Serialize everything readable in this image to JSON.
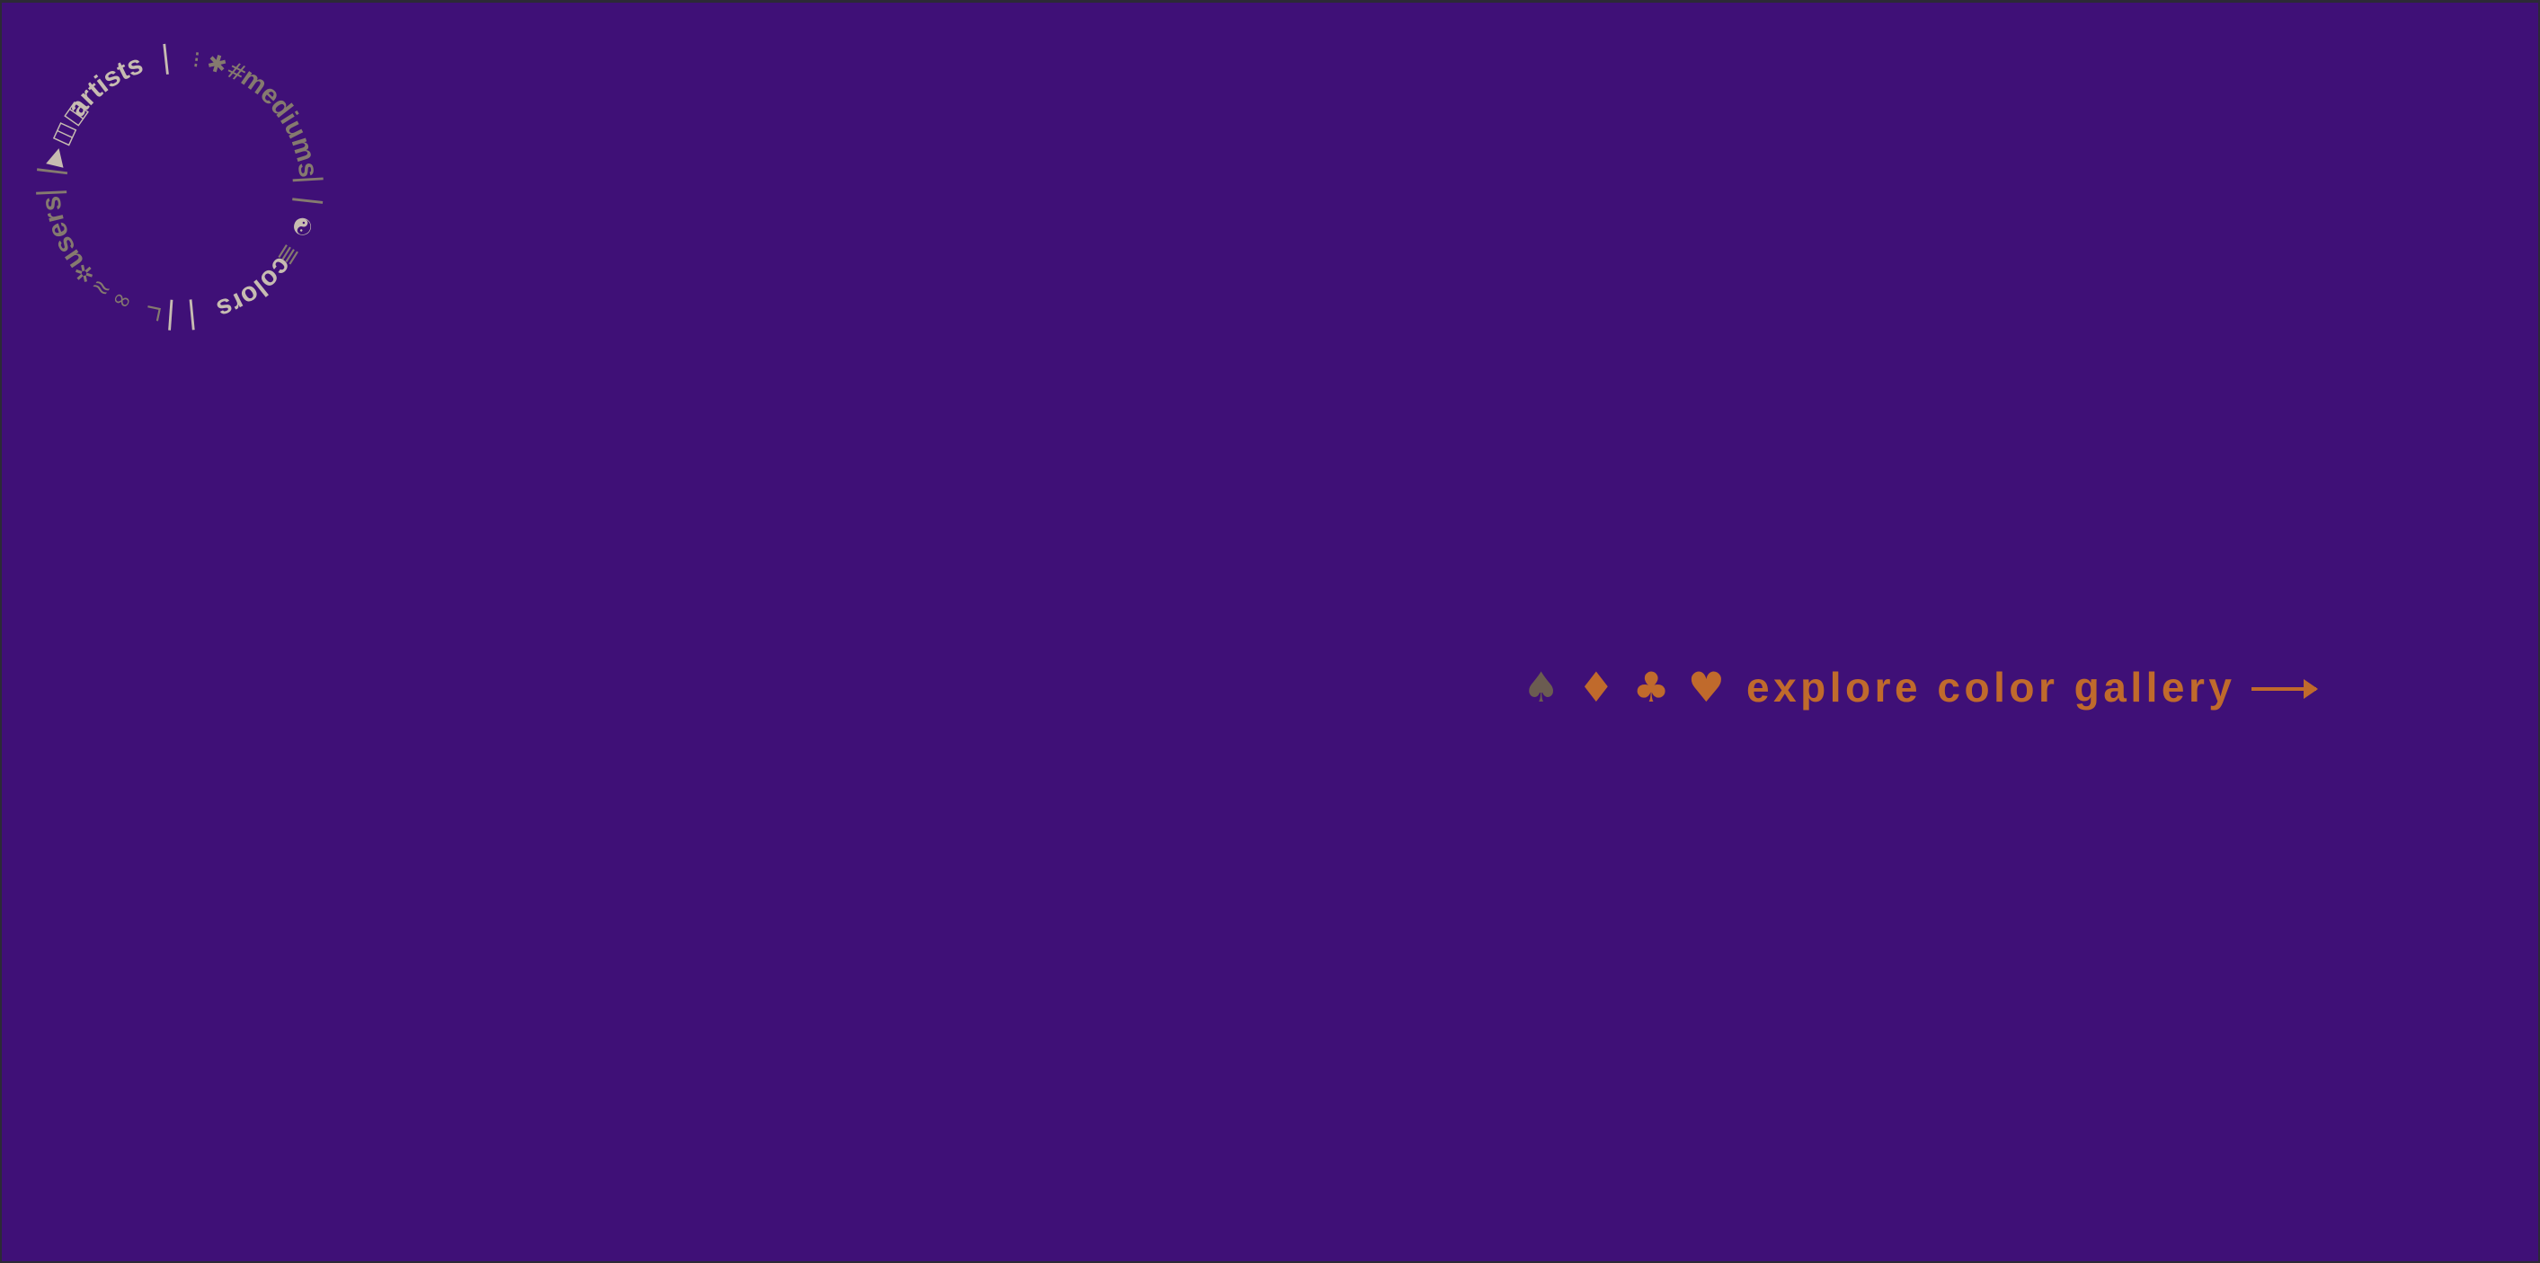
{
  "colors": {
    "background": "#3f1077",
    "accent": "#c06a2c",
    "muted": "#6b5c51",
    "ring_light": "#c7bcb1",
    "ring_dim": "#857a6f"
  },
  "ring_nav": {
    "words": [
      {
        "label": "artists",
        "name": "ring-link-artists"
      },
      {
        "label": "mediums",
        "name": "ring-link-mediums"
      },
      {
        "label": "colors",
        "name": "ring-link-colors"
      },
      {
        "label": "users",
        "name": "ring-link-users"
      }
    ],
    "symbols": {
      "play": "▶",
      "grid": "◫◫",
      "dots": "⁝",
      "asterisk": "✱",
      "hash": "#",
      "yinyang": "☯",
      "stack": "≣",
      "corner": "∟",
      "infinity": "∞",
      "tilde": "≈",
      "star": "✲",
      "separator": "| |"
    }
  },
  "cta": {
    "label": "explore color gallery",
    "suits": {
      "spade": "♠",
      "diamond": "♦",
      "club": "♣",
      "heart": "♥"
    },
    "icons": [
      "spade-icon",
      "diamond-icon",
      "club-icon",
      "heart-icon",
      "arrow-right-icon"
    ]
  }
}
